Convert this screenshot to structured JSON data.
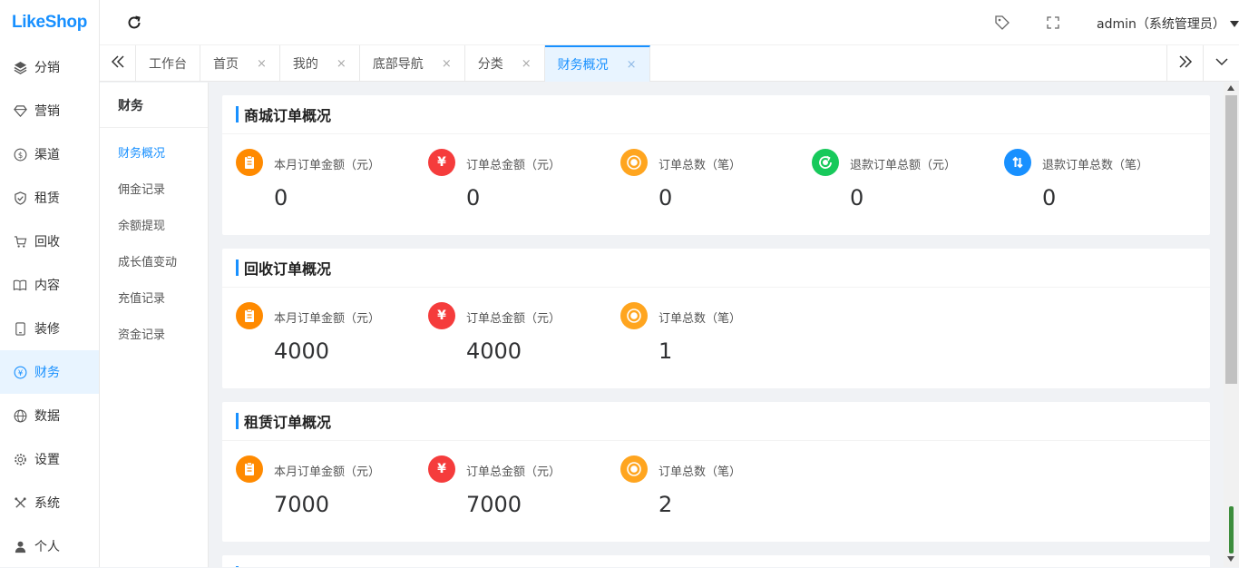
{
  "app": {
    "logo": "LikeShop",
    "colors": {
      "accent": "#1890ff",
      "orange": "#ff8a00",
      "red": "#f53c3c",
      "gold": "#ffa51f",
      "green": "#17c95b",
      "blue": "#1890ff"
    }
  },
  "sidebar": {
    "items": [
      {
        "label": "分销",
        "icon": "layers-icon"
      },
      {
        "label": "营销",
        "icon": "diamond-icon"
      },
      {
        "label": "渠道",
        "icon": "dollar-circle-icon"
      },
      {
        "label": "租赁",
        "icon": "shield-check-icon"
      },
      {
        "label": "回收",
        "icon": "cart-icon"
      },
      {
        "label": "内容",
        "icon": "book-icon"
      },
      {
        "label": "装修",
        "icon": "tablet-icon"
      },
      {
        "label": "财务",
        "icon": "yen-circle-icon"
      },
      {
        "label": "数据",
        "icon": "globe-icon"
      },
      {
        "label": "设置",
        "icon": "gear-icon"
      },
      {
        "label": "系统",
        "icon": "tools-icon"
      },
      {
        "label": "个人",
        "icon": "user-icon"
      }
    ],
    "active": "财务"
  },
  "header": {
    "user": "admin（系统管理员）"
  },
  "tabs": {
    "items": [
      {
        "label": "工作台",
        "closable": false
      },
      {
        "label": "首页",
        "closable": true
      },
      {
        "label": "我的",
        "closable": true
      },
      {
        "label": "底部导航",
        "closable": true
      },
      {
        "label": "分类",
        "closable": true
      },
      {
        "label": "财务概况",
        "closable": true
      }
    ],
    "active": "财务概况",
    "close_glyph": "×"
  },
  "submenu": {
    "title": "财务",
    "items": [
      "财务概况",
      "佣金记录",
      "余额提现",
      "成长值变动",
      "充值记录",
      "资金记录"
    ],
    "active": "财务概况"
  },
  "cards": [
    {
      "title": "商城订单概况",
      "stats": [
        {
          "label": "本月订单金额（元）",
          "value": "0",
          "icon": "clipboard-icon"
        },
        {
          "label": "订单总金额（元）",
          "value": "0",
          "icon": "yen-icon"
        },
        {
          "label": "订单总数（笔）",
          "value": "0",
          "icon": "coin-icon"
        },
        {
          "label": "退款订单总额（元）",
          "value": "0",
          "icon": "refund-coin-icon"
        },
        {
          "label": "退款订单总数（笔）",
          "value": "0",
          "icon": "swap-arrows-icon"
        }
      ]
    },
    {
      "title": "回收订单概况",
      "stats": [
        {
          "label": "本月订单金额（元）",
          "value": "4000",
          "icon": "clipboard-icon"
        },
        {
          "label": "订单总金额（元）",
          "value": "4000",
          "icon": "yen-icon"
        },
        {
          "label": "订单总数（笔）",
          "value": "1",
          "icon": "coin-icon"
        }
      ]
    },
    {
      "title": "租赁订单概况",
      "stats": [
        {
          "label": "本月订单金额（元）",
          "value": "7000",
          "icon": "clipboard-icon"
        },
        {
          "label": "订单总金额（元）",
          "value": "7000",
          "icon": "yen-icon"
        },
        {
          "label": "订单总数（笔）",
          "value": "2",
          "icon": "coin-icon"
        }
      ]
    }
  ]
}
